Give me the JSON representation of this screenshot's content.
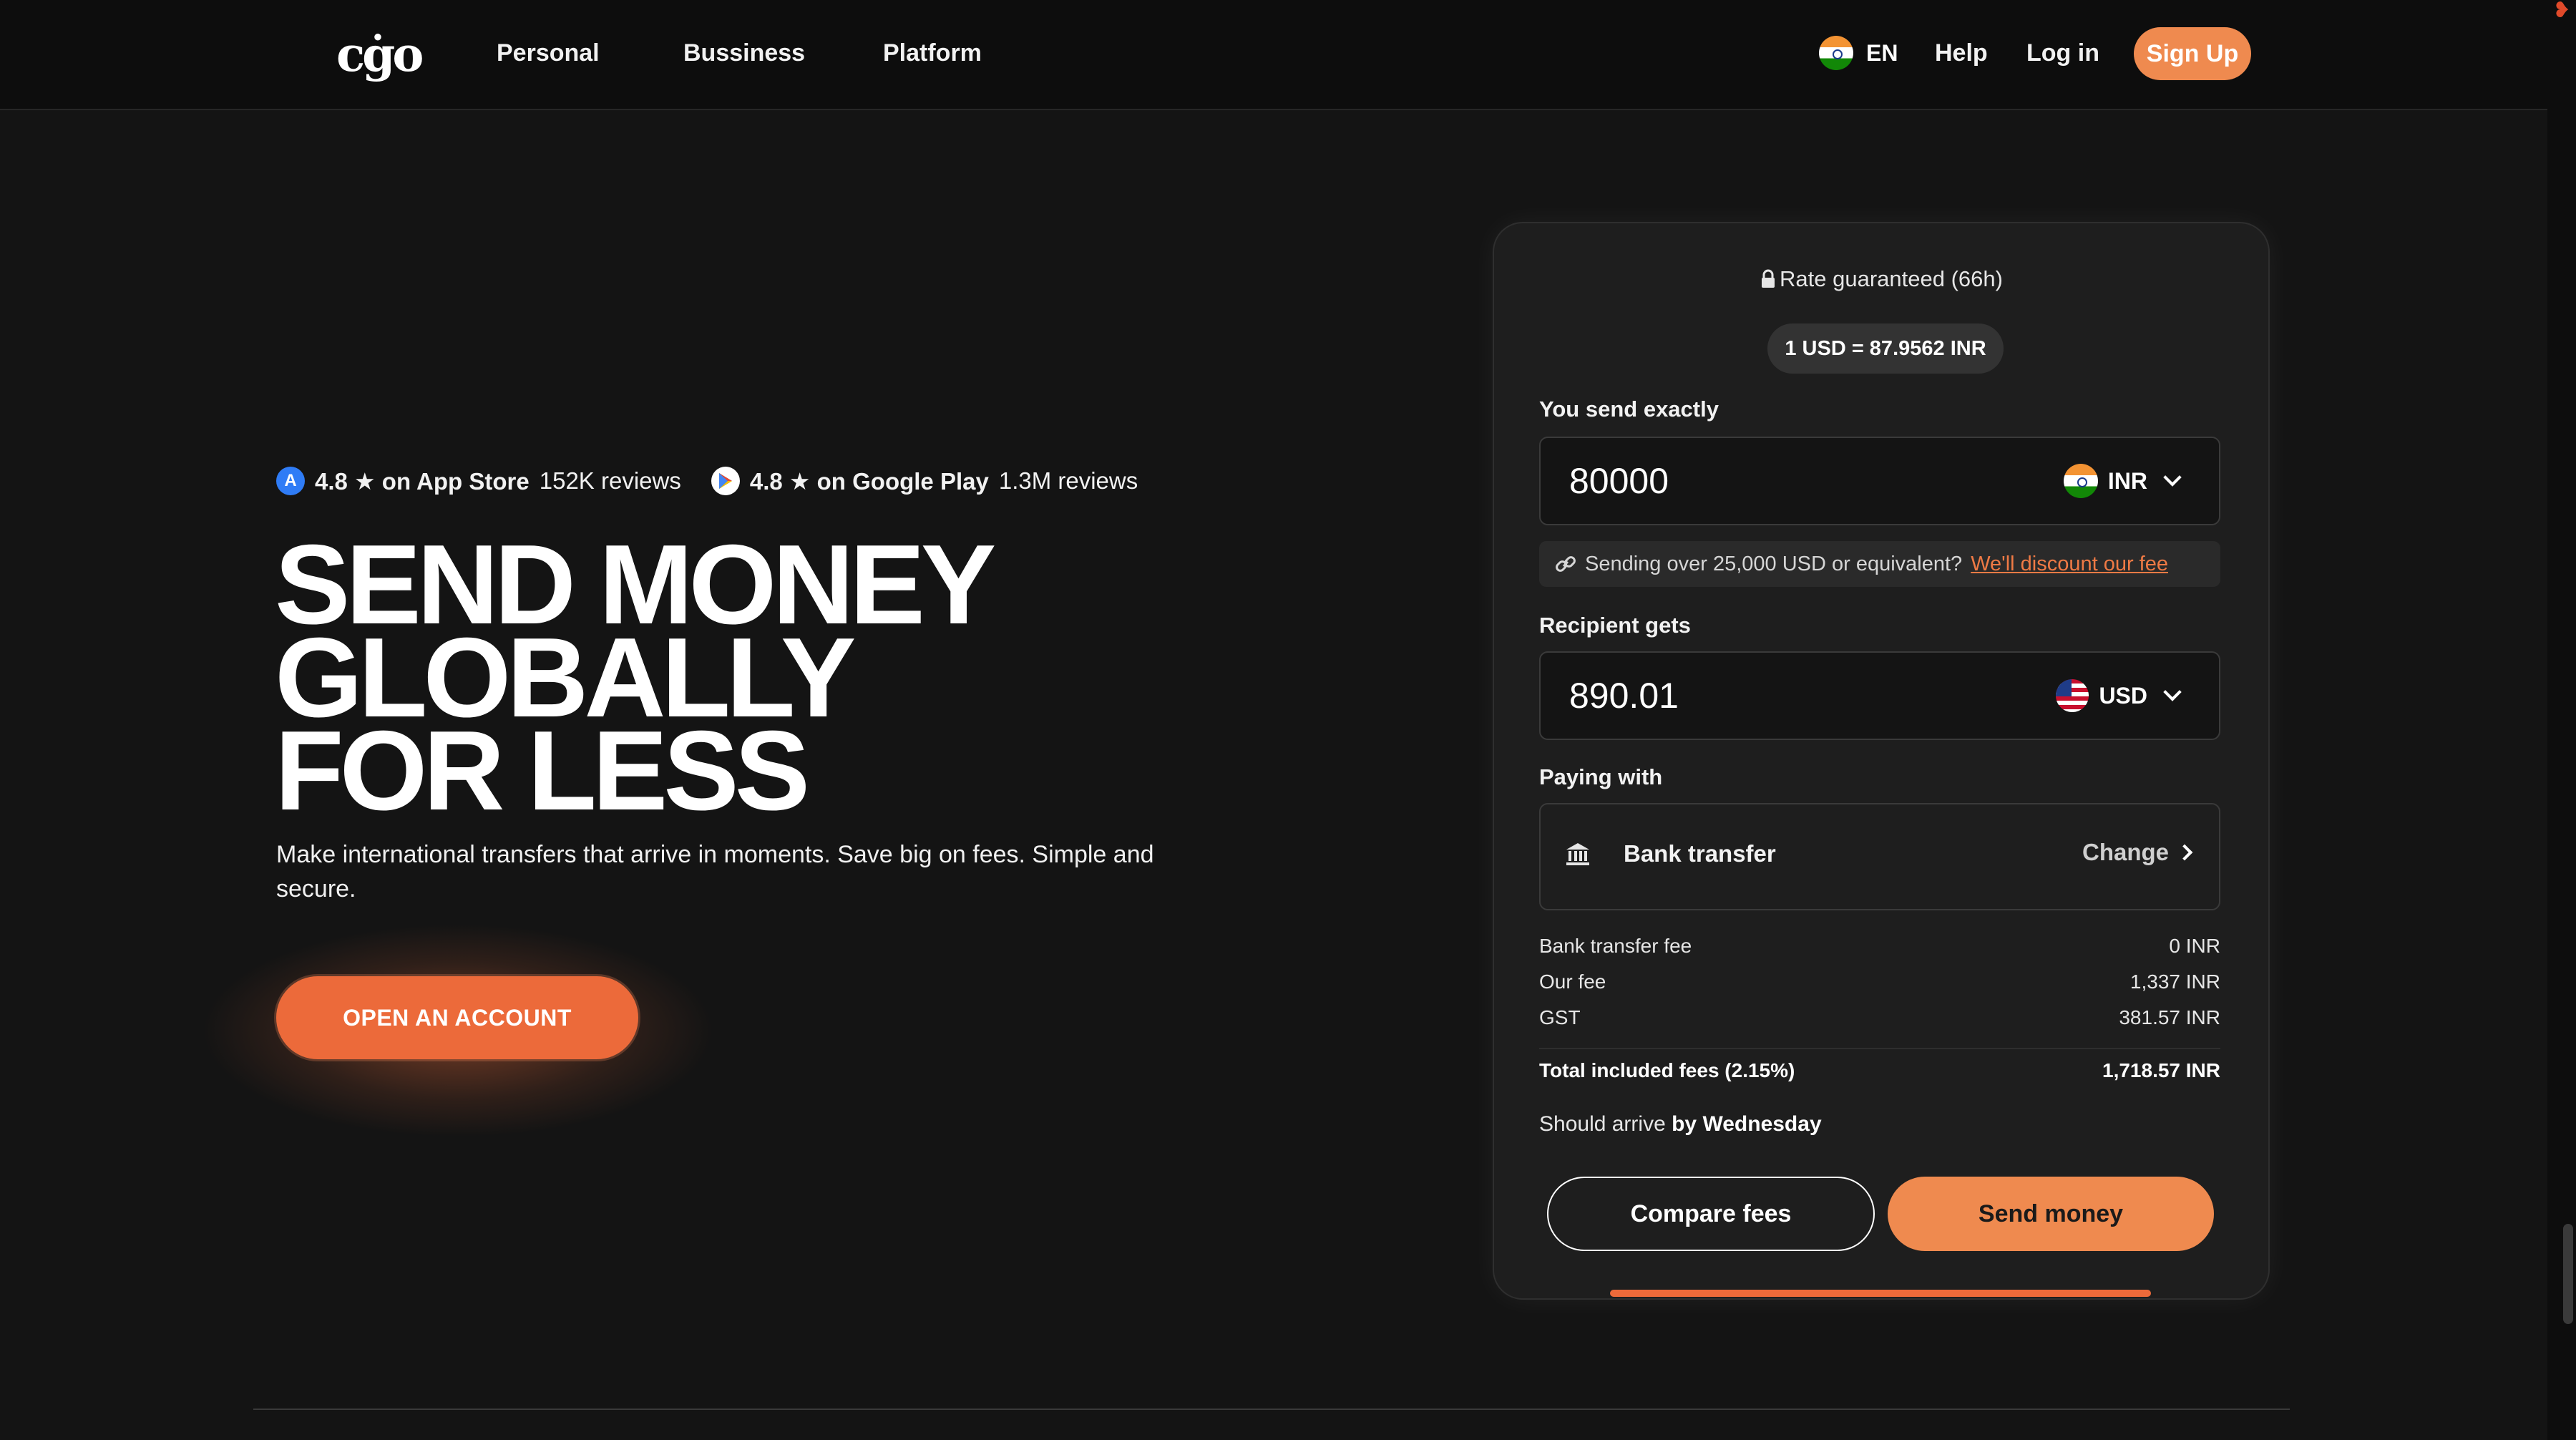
{
  "header": {
    "logo": "cġo",
    "nav": [
      "Personal",
      "Bussiness",
      "Platform"
    ],
    "language": "EN",
    "help": "Help",
    "login": "Log in",
    "signup": "Sign Up"
  },
  "hero": {
    "ratings": [
      {
        "score": "4.8 ★ on App Store",
        "reviews": "152K reviews",
        "icon": "app-store-icon"
      },
      {
        "score": "4.8 ★ on Google Play",
        "reviews": "1.3M reviews",
        "icon": "google-play-icon"
      }
    ],
    "headline": [
      "SEND MONEY",
      "GLOBALLY",
      "FOR LESS"
    ],
    "subtext": "Make international transfers that arrive in moments. Save big on fees. Simple and secure.",
    "cta": "OPEN AN ACCOUNT"
  },
  "converter": {
    "rate_guarantee": "Rate guaranteed (66h)",
    "rate": "1 USD = 87.9562 INR",
    "send_label": "You send exactly",
    "send_amount": "80000",
    "send_currency": "INR",
    "discount_text": "Sending over 25,000 USD or equivalent?",
    "discount_link": "We'll discount our fee",
    "receive_label": "Recipient gets",
    "receive_amount": "890.01",
    "receive_currency": "USD",
    "paying_label": "Paying with",
    "payment_method": "Bank transfer",
    "change": "Change",
    "fees": [
      {
        "label": "Bank transfer fee",
        "value": "0 INR"
      },
      {
        "label": "Our fee",
        "value": "1,337 INR"
      },
      {
        "label": "GST",
        "value": "381.57 INR"
      }
    ],
    "total": {
      "label": "Total included fees (2.15%)",
      "value": "1,718.57 INR"
    },
    "arrive_prefix": "Should arrive",
    "arrive_day": "by Wednesday",
    "compare_button": "Compare fees",
    "send_button": "Send money"
  },
  "colors": {
    "accent": "#ef8a4f",
    "cta": "#ec6a3a",
    "background": "#141414",
    "card": "#1e1e1e"
  }
}
